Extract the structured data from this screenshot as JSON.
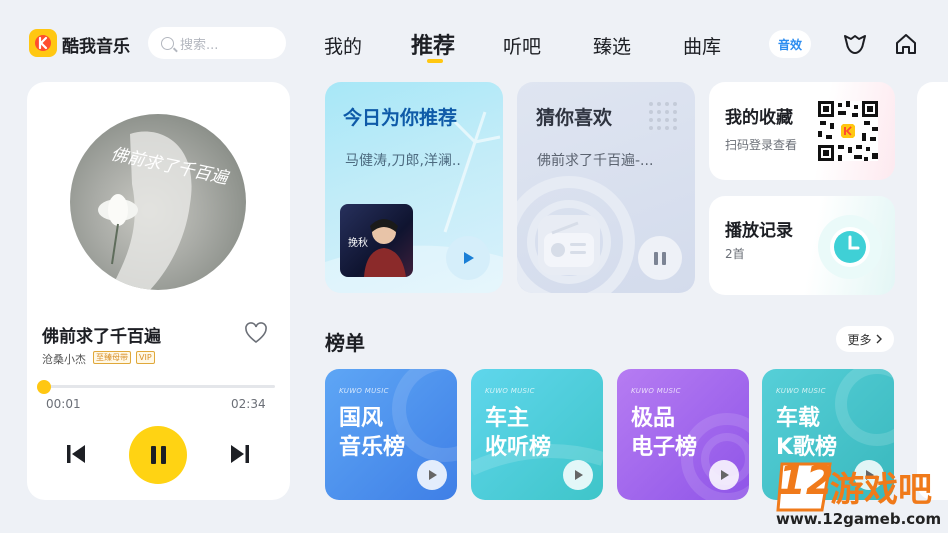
{
  "app": {
    "name": "酷我音乐"
  },
  "search": {
    "placeholder": "搜索..."
  },
  "nav": {
    "items": [
      "我的",
      "推荐",
      "听吧",
      "臻选",
      "曲库"
    ],
    "active": "推荐",
    "sound_effect": "音效"
  },
  "player": {
    "song": "佛前求了千百遍",
    "artist": "沧桑小杰",
    "quality_tag": "至臻母带",
    "vip_tag": "VIP",
    "cover_text": "佛前求了千百遍",
    "current_time": "00:01",
    "total_time": "02:34",
    "progress": 0.01
  },
  "cards": {
    "today": {
      "title": "今日为你推荐",
      "subtitle": "马健涛,刀郎,洋澜..",
      "art_text": "挽秋"
    },
    "guess": {
      "title": "猜你喜欢",
      "subtitle": "佛前求了千百遍-..."
    },
    "favorites": {
      "title": "我的收藏",
      "subtitle": "扫码登录查看"
    },
    "history": {
      "title": "播放记录",
      "count": "2首"
    }
  },
  "charts": {
    "title": "榜单",
    "more": "更多",
    "brand": "KUWO MUSIC",
    "items": [
      {
        "line1": "国风",
        "line2": "音乐榜"
      },
      {
        "line1": "车主",
        "line2": "收听榜"
      },
      {
        "line1": "极品",
        "line2": "电子榜"
      },
      {
        "line1": "车载",
        "line2": "K歌榜"
      }
    ]
  },
  "watermark": {
    "number": "12",
    "text": "游戏吧",
    "url": "www.12gameb.com"
  },
  "colors": {
    "accent": "#ffc712",
    "background": "#eef1f6",
    "sound_effect": "#2b8cf0"
  }
}
